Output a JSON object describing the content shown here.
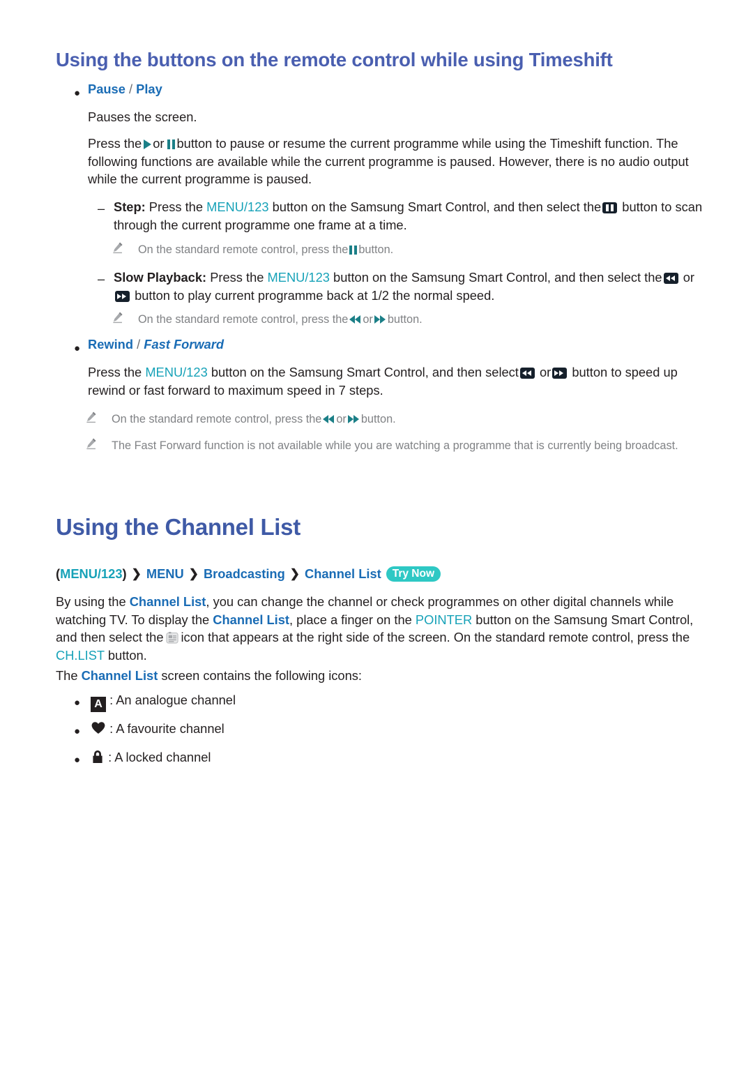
{
  "document": {
    "section_heading": "Using the buttons on the remote control while using Timeshift",
    "page_heading": "Using the Channel List"
  },
  "timeshift": {
    "bullets": [
      {
        "title_a": "Pause",
        "separator": "/",
        "title_b": "Play",
        "intro": "Pauses the screen.",
        "paragraph_lead": "Press the",
        "paragraph_mid": "or",
        "paragraph_tail": "button to pause or resume the current programme while using the Timeshift function. The following functions are available while the current programme is paused. However, there is no audio output while the current programme is paused."
      },
      {
        "title_a": "Rewind",
        "separator": "/",
        "title_b": "Fast Forward",
        "paragraph_lead": "Press the",
        "menu_key": "MENU/123",
        "paragraph_mid": "button on the Samsung Smart Control, and then select",
        "paragraph_or": "or",
        "paragraph_tail": "button to speed up rewind or fast forward to maximum speed in 7 steps."
      }
    ],
    "sub_items": [
      {
        "label": "Step:",
        "lead": "Press the",
        "menu_key": "MENU/123",
        "mid": "button on the Samsung Smart Control, and then select the",
        "tail": "button to scan through the current programme one frame at a time.",
        "note_lead": "On the standard remote control, press the",
        "note_tail": "button."
      },
      {
        "label": "Slow Playback:",
        "lead": "Press the",
        "menu_key": "MENU/123",
        "mid": "button on the Samsung Smart Control, and then select the",
        "or": "or",
        "tail": "button to play current programme back at 1/2 the normal speed.",
        "note_lead": "On the standard remote control, press the",
        "note_or": "or",
        "note_tail": "button."
      }
    ],
    "notes": [
      {
        "lead": "On the standard remote control, press the",
        "or": "or",
        "tail": "button."
      },
      {
        "text": "The Fast Forward function is not available while you are watching a programme that is currently being broadcast."
      }
    ]
  },
  "channel_list": {
    "breadcrumb": {
      "open_paren": "(",
      "menu_key": "MENU/123",
      "close_paren": ")",
      "separator": "❯",
      "items": [
        "MENU",
        "Broadcasting",
        "Channel List"
      ],
      "badge": "Try Now"
    },
    "paragraph": {
      "p1_lead": "By using the",
      "p1_link": "Channel List",
      "p1_mid": ", you can change the channel or check programmes on other digital channels while watching TV. To display the",
      "p2_link": "Channel List",
      "p2_mid": ", place a finger on the",
      "pointer_key": "POINTER",
      "p3_mid": "button on the Samsung Smart Control, and then select the",
      "p3_tail": "icon that appears at the right side of the screen. On the standard remote control, press the",
      "chlist_key": "CH.LIST",
      "p4_tail": "button."
    },
    "icons_intro_lead": "The",
    "icons_intro_link": "Channel List",
    "icons_intro_tail": "screen contains the following icons:",
    "legend": [
      {
        "icon": "analogue-channel-icon",
        "glyph": "A",
        "text": ": An analogue channel"
      },
      {
        "icon": "favourite-channel-icon",
        "glyph": "heart",
        "text": ": A favourite channel"
      },
      {
        "icon": "locked-channel-icon",
        "glyph": "lock",
        "text": ": A locked channel"
      }
    ]
  },
  "colors": {
    "heading_purple": "#4a5fb0",
    "heading_blue": "#3f5aa6",
    "link_blue": "#1a6cb5",
    "accent_cyan": "#17a2b8",
    "badge_teal": "#2ec8c4",
    "icon_teal": "#1b7f87",
    "body_text": "#231f20",
    "note_gray": "#808285"
  }
}
